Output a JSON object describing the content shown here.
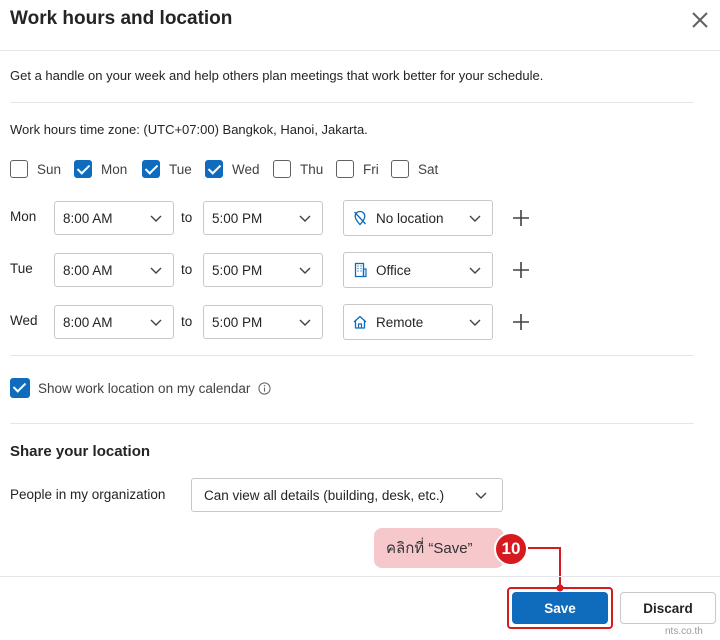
{
  "dialog": {
    "title": "Work hours and location",
    "intro": "Get a handle on your week and help others plan meetings that work better for your schedule.",
    "timezone": "Work hours time zone: (UTC+07:00) Bangkok, Hanoi, Jakarta."
  },
  "days": [
    {
      "label": "Sun",
      "checked": false
    },
    {
      "label": "Mon",
      "checked": true
    },
    {
      "label": "Tue",
      "checked": true
    },
    {
      "label": "Wed",
      "checked": true
    },
    {
      "label": "Thu",
      "checked": false
    },
    {
      "label": "Fri",
      "checked": false
    },
    {
      "label": "Sat",
      "checked": false
    }
  ],
  "schedule": {
    "to_label": "to",
    "rows": [
      {
        "day": "Mon",
        "start": "8:00 AM",
        "end": "5:00 PM",
        "location": "No location",
        "location_icon": "no-location-icon"
      },
      {
        "day": "Tue",
        "start": "8:00 AM",
        "end": "5:00 PM",
        "location": "Office",
        "location_icon": "building-icon"
      },
      {
        "day": "Wed",
        "start": "8:00 AM",
        "end": "5:00 PM",
        "location": "Remote",
        "location_icon": "home-icon"
      }
    ]
  },
  "show_location": {
    "label": "Show work location on my calendar",
    "checked": true
  },
  "share": {
    "heading": "Share your location",
    "people_label": "People in my organization",
    "people_value": "Can view all details (building, desk, etc.)"
  },
  "annotation": {
    "callout": "คลิกที่ “Save”",
    "step": "10"
  },
  "footer": {
    "save_label": "Save",
    "discard_label": "Discard"
  },
  "watermark": "nts.co.th",
  "colors": {
    "accent": "#0f6cbd",
    "annotation": "#d71920",
    "callout_bg": "#f6c8cc"
  }
}
